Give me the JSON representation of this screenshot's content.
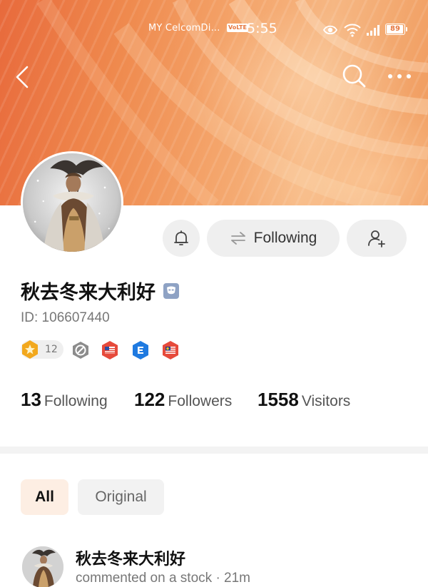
{
  "status_bar": {
    "carrier": "MY CelcomDi...",
    "volte": "VoLTE",
    "time": "5:55",
    "battery": "89",
    "battery_level": 0.89
  },
  "nav": {
    "back_icon": "chevron-left-icon",
    "search_icon": "search-icon",
    "more_icon": "more-horizontal-icon"
  },
  "actions": {
    "bell_icon": "bell-icon",
    "follow_icon": "swap-arrows-icon",
    "follow_label": "Following",
    "add_user_icon": "add-user-icon"
  },
  "profile": {
    "name": "秋去冬来大利好",
    "id_label": "ID: 106607440",
    "level": "12"
  },
  "stats": [
    {
      "value": "13",
      "label": "Following"
    },
    {
      "value": "122",
      "label": "Followers"
    },
    {
      "value": "1558",
      "label": "Visitors"
    }
  ],
  "tabs": {
    "all": "All",
    "original": "Original"
  },
  "feed": {
    "item": {
      "name": "秋去冬来大利好",
      "action": "commented on a stock",
      "separator": "·",
      "time": "21m"
    }
  },
  "colors": {
    "accent": "#e86a3c",
    "tab_active_bg": "#fdeee3",
    "button_bg": "#efefef"
  }
}
